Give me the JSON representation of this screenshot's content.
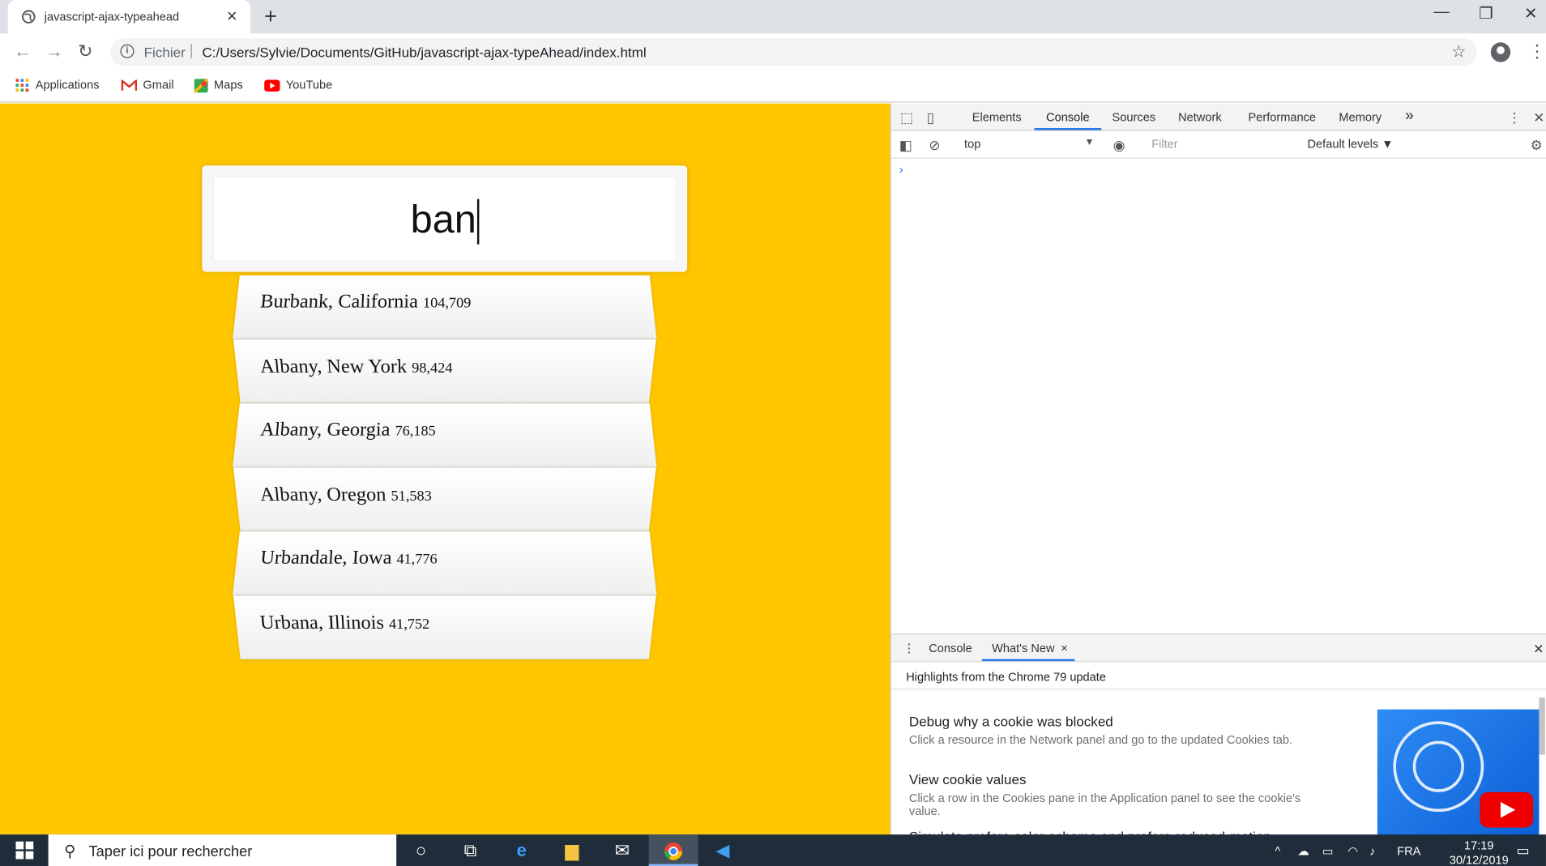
{
  "browser": {
    "tab_title": "javascript-ajax-typeahead",
    "new_tab_label": "+",
    "scheme_label": "Fichier",
    "url": "C:/Users/Sylvie/Documents/GitHub/javascript-ajax-typeAhead/index.html",
    "bookmarks": [
      {
        "label": "Applications",
        "icon": "apps-grid-icon"
      },
      {
        "label": "Gmail",
        "icon": "gmail-icon"
      },
      {
        "label": "Maps",
        "icon": "maps-icon"
      },
      {
        "label": "YouTube",
        "icon": "youtube-icon"
      }
    ]
  },
  "page": {
    "background_color": "#ffc600",
    "search_value": "ban",
    "suggestions": [
      {
        "place": "Burbank, California",
        "population": "104,709"
      },
      {
        "place": "Albany, New York",
        "population": "98,424"
      },
      {
        "place": "Albany, Georgia",
        "population": "76,185"
      },
      {
        "place": "Albany, Oregon",
        "population": "51,583"
      },
      {
        "place": "Urbandale, Iowa",
        "population": "41,776"
      },
      {
        "place": "Urbana, Illinois",
        "population": "41,752"
      }
    ]
  },
  "devtools": {
    "tabs": [
      "Elements",
      "Console",
      "Sources",
      "Network",
      "Performance",
      "Memory"
    ],
    "active_tab": "Console",
    "more_tabs": "»",
    "context": "top",
    "filter_placeholder": "Filter",
    "levels": "Default levels ▼",
    "prompt": "›",
    "drawer": {
      "tabs": [
        "Console",
        "What's New"
      ],
      "active_tab": "What's New",
      "highlights": "Highlights from the Chrome 79 update",
      "items": [
        {
          "title": "Debug why a cookie was blocked",
          "desc": "Click a resource in the Network panel and go to the updated Cookies tab."
        },
        {
          "title": "View cookie values",
          "desc": "Click a row in the Cookies pane in the Application panel to see the cookie's value."
        },
        {
          "title": "Simulate prefers-color-scheme and prefers-reduced-motion",
          "desc": ""
        }
      ]
    }
  },
  "taskbar": {
    "search_placeholder": "Taper ici pour rechercher",
    "language": "FRA",
    "time": "17:19",
    "date": "30/12/2019",
    "accent_color": "#1f2d3a"
  }
}
